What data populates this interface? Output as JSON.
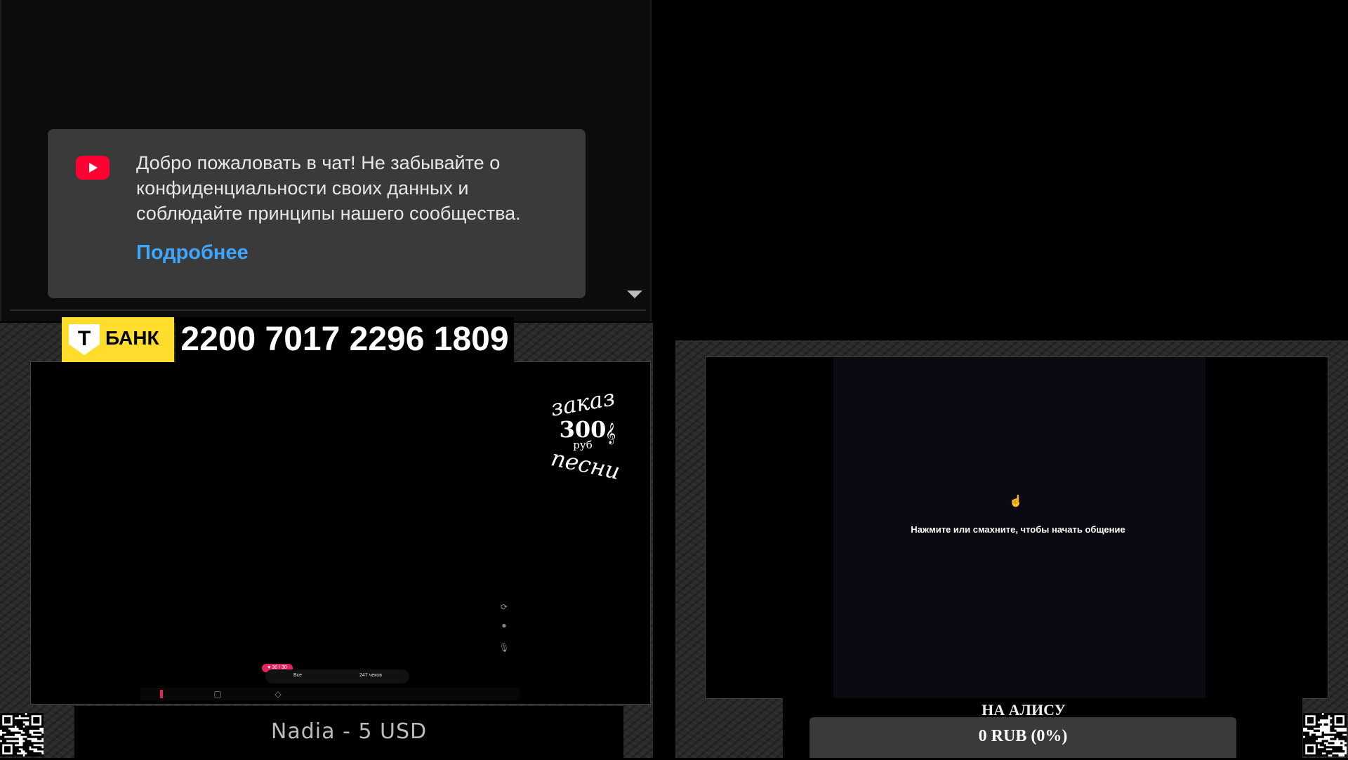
{
  "chat": {
    "welcome": "Добро пожаловать в чат! Не забывайте о конфиденциальности своих данных и соблюдайте принципы нашего сообщества.",
    "learn_more": "Подробнее"
  },
  "bank": {
    "logo_letter": "Т",
    "name": "БАНК",
    "card_number": "2200 7017 2296 1809",
    "brand_color": "#ffdd2d"
  },
  "order": {
    "top": "заказ",
    "price": "300",
    "unit": "руб",
    "bottom": "песни"
  },
  "app": {
    "likes": "♥ 30 / 30",
    "all_label": "Все",
    "checks_label": "247 чеков"
  },
  "right_screen": {
    "hint": "Нажмите или смахните, чтобы начать общение"
  },
  "donation": {
    "last": "Nadia - 5 USD"
  },
  "goal": {
    "title": "НА АЛИСУ",
    "value": "0 RUB (0%)",
    "progress_percent": 0
  },
  "icons": {
    "youtube": "youtube-icon",
    "refresh": "refresh-icon",
    "record": "record-icon",
    "mic": "mic-icon",
    "hand": "hand-icon"
  }
}
